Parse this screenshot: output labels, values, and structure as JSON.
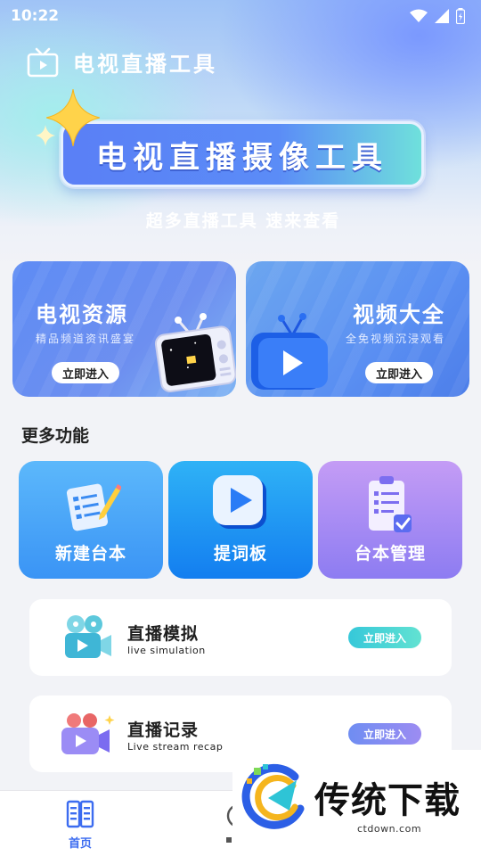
{
  "status_bar": {
    "time": "10:22"
  },
  "header": {
    "app_title": "电视直播工具"
  },
  "banner": {
    "text": "电视直播摄像工具",
    "tagline": "超多直播工具  速来查看"
  },
  "feature_cards": [
    {
      "title": "电视资源",
      "subtitle": "精品频道资讯盛宴",
      "button": "立即进入"
    },
    {
      "title": "视频大全",
      "subtitle": "全免视频沉浸观看",
      "button": "立即进入"
    }
  ],
  "more_section": {
    "title": "更多功能"
  },
  "tools": [
    {
      "label": "新建台本",
      "icon": "notebook-pencil-icon"
    },
    {
      "label": "提词板",
      "icon": "play-screen-icon"
    },
    {
      "label": "台本管理",
      "icon": "clipboard-check-icon"
    }
  ],
  "list_items": [
    {
      "title": "直播模拟",
      "subtitle": "live simulation",
      "button": "立即进入",
      "icon": "camera-film-icon"
    },
    {
      "title": "直播记录",
      "subtitle": "Live stream recap",
      "button": "立即进入",
      "icon": "video-camera-icon"
    }
  ],
  "tab_bar": {
    "home_label": "首页"
  },
  "watermark": {
    "brand": "传统下载",
    "url": "ctdown.com"
  },
  "colors": {
    "accent": "#3c6cf0",
    "tile_blue": "#3a94f5",
    "tile_purple": "#8d7cf2"
  }
}
